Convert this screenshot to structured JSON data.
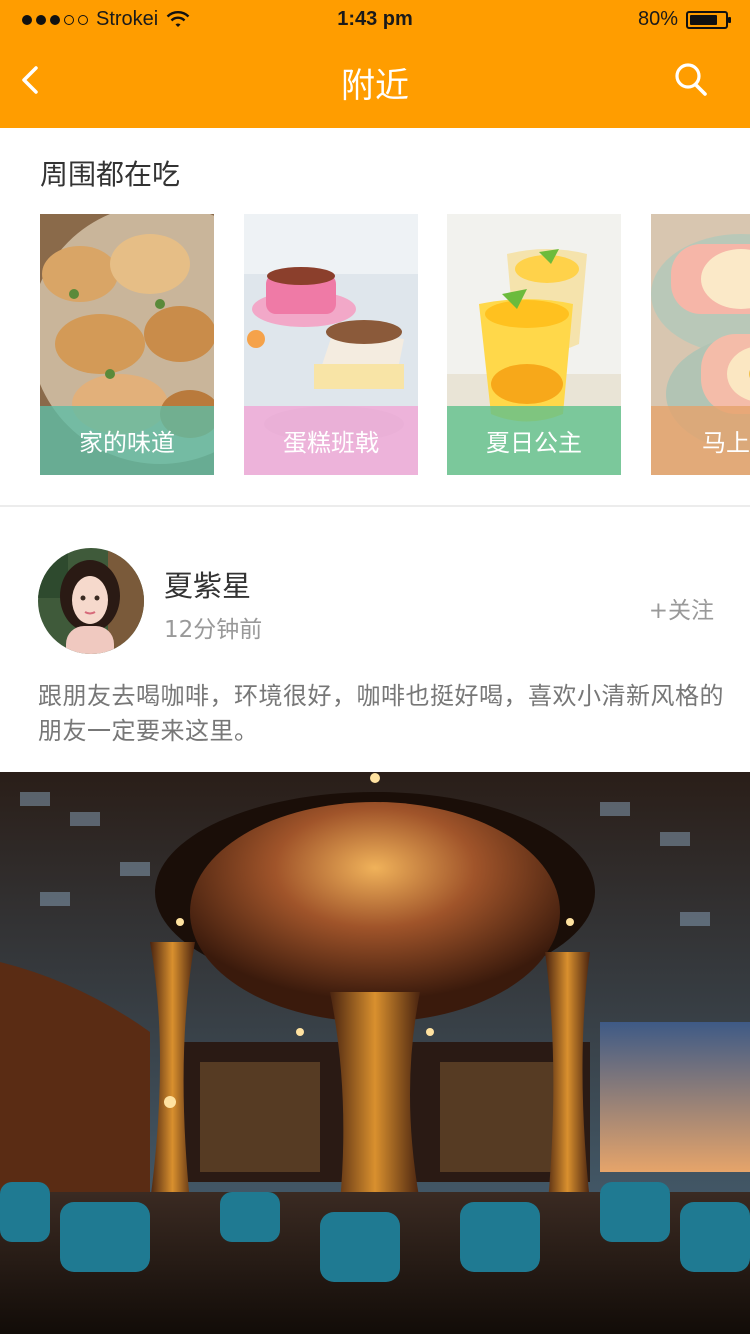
{
  "status_bar": {
    "carrier": "Strokei",
    "time": "1:43 pm",
    "battery_text": "80%",
    "battery_level": 0.8,
    "signal_filled": 3,
    "signal_total": 5
  },
  "nav": {
    "title": "附近",
    "back_icon": "chevron-left-icon",
    "search_icon": "search-icon"
  },
  "nearby": {
    "title": "周围都在吃",
    "cards": [
      {
        "label": "家的味道",
        "accent": "#5FBDA5"
      },
      {
        "label": "蛋糕班戟",
        "accent": "#F0A6D6"
      },
      {
        "label": "夏日公主",
        "accent": "#5FC08C"
      },
      {
        "label": "马上解",
        "accent": "#E5A36B"
      }
    ]
  },
  "post": {
    "username": "夏紫星",
    "time_ago": "12分钟前",
    "follow_label": "+关注",
    "text": "跟朋友去喝咖啡，环境很好，咖啡也挺好喝，喜欢小清新风格的朋友一定要来这里。"
  },
  "colors": {
    "brand": "#FF9D00",
    "text_dark": "#333333",
    "text_muted": "#999999"
  }
}
